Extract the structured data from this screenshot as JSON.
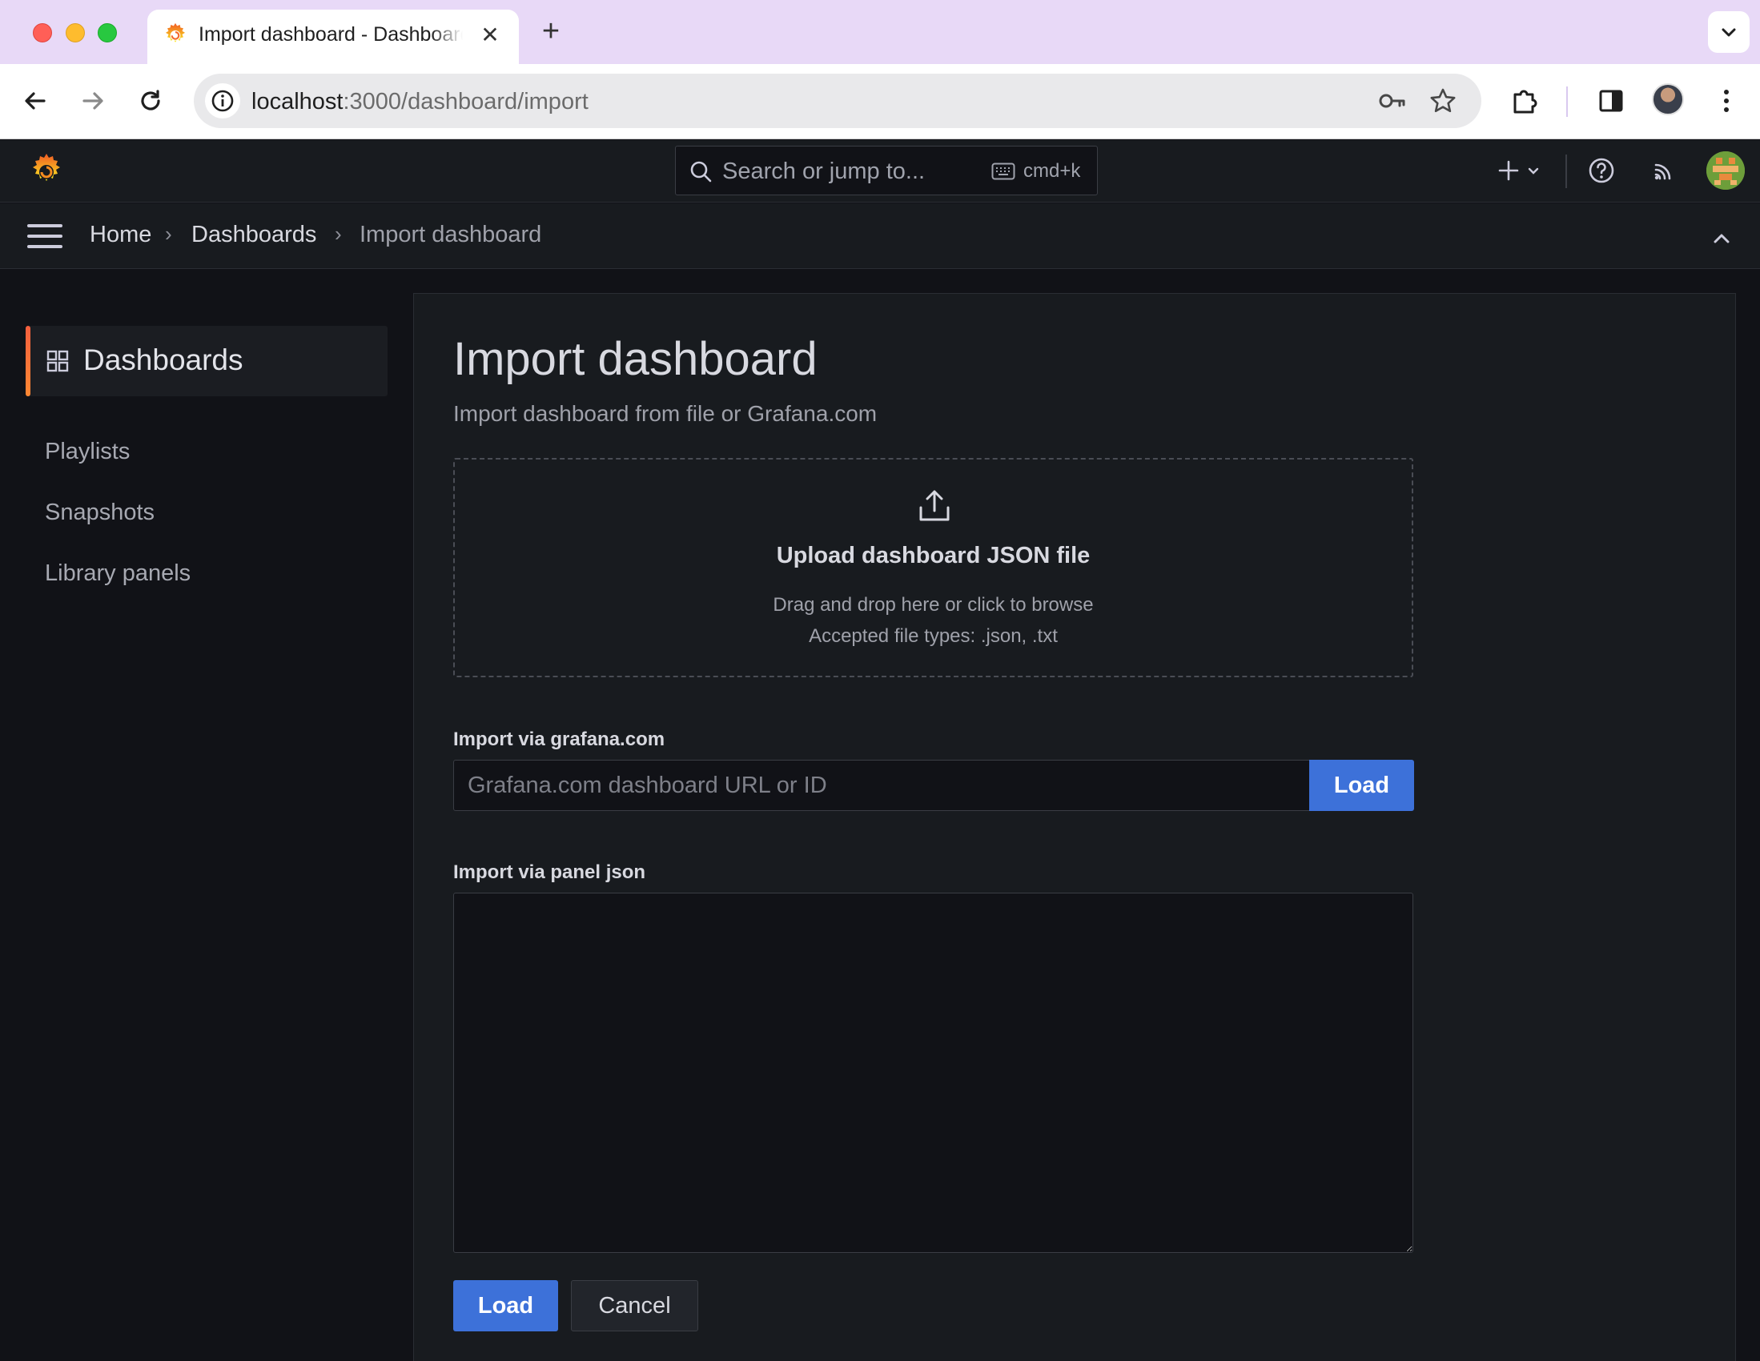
{
  "browser": {
    "tab_title": "Import dashboard - Dashboards - Grafana",
    "url_host": "localhost",
    "url_path": ":3000/dashboard/import",
    "new_tab_glyph": "+",
    "close_glyph": "✕",
    "icons": [
      "back-icon",
      "forward-icon",
      "reload-icon",
      "info-icon",
      "key-icon",
      "star-icon",
      "extensions-icon",
      "side-panel-icon",
      "profile-avatar",
      "kebab-menu-icon"
    ]
  },
  "grafana": {
    "accent_color": "#f55f3e",
    "primary_button_color": "#3d71d9",
    "search": {
      "placeholder": "Search or jump to...",
      "shortcut": "cmd+k"
    },
    "top_icons": [
      "plus-icon",
      "chevron-down-icon",
      "help-icon",
      "news-rss-icon",
      "user-avatar"
    ],
    "breadcrumbs": [
      "Home",
      "Dashboards",
      "Import dashboard"
    ],
    "breadcrumb_separator": "›"
  },
  "sidebar": {
    "active": "Dashboards",
    "items": [
      "Playlists",
      "Snapshots",
      "Library panels"
    ]
  },
  "main": {
    "title": "Import dashboard",
    "subtitle": "Import dashboard from file or Grafana.com",
    "upload": {
      "title": "Upload dashboard JSON file",
      "hint_1": "Drag and drop here or click to browse",
      "hint_2": "Accepted file types: .json, .txt"
    },
    "grafana_com": {
      "label": "Import via grafana.com",
      "placeholder": "Grafana.com dashboard URL or ID",
      "value": "",
      "button": "Load"
    },
    "panel_json": {
      "label": "Import via panel json",
      "value": ""
    },
    "actions": {
      "load": "Load",
      "cancel": "Cancel"
    }
  }
}
